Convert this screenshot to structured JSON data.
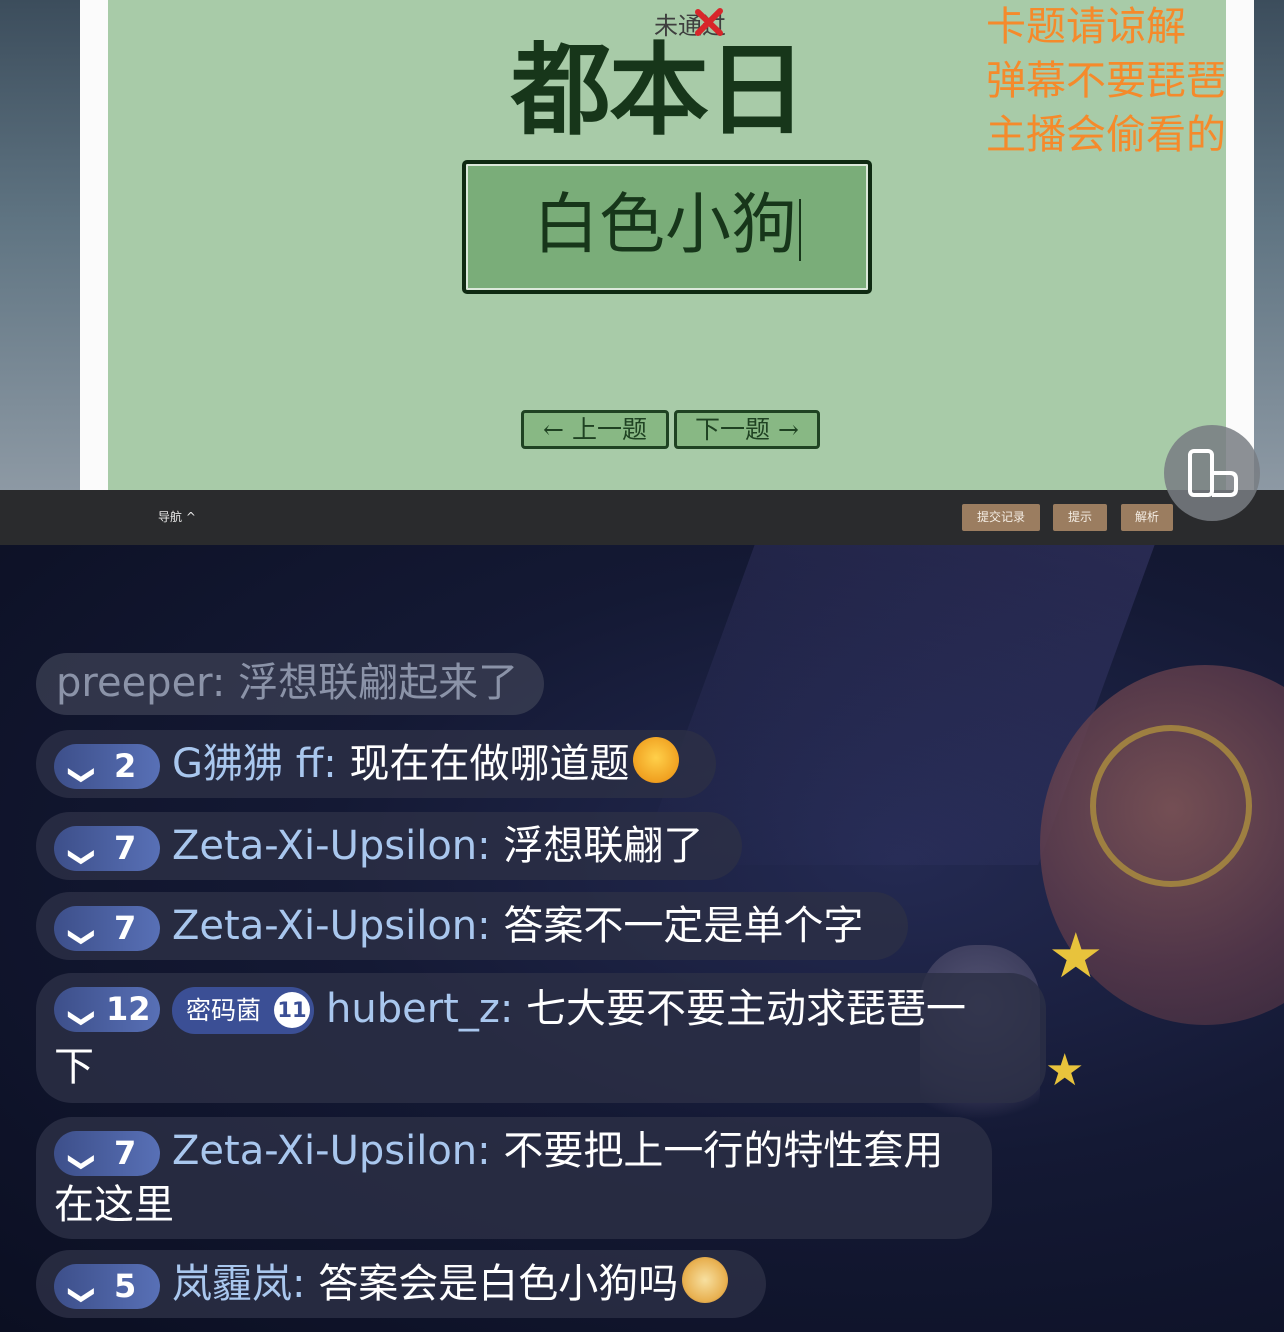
{
  "stream": {
    "status_text": "未通过",
    "question": "都本日",
    "answer": "白色小狗",
    "prev_button": "←  上一题",
    "next_button": "下一题  →",
    "notice_lines": [
      "卡题请谅解",
      "弹幕不要琵琶",
      "主播会偷看的"
    ]
  },
  "toolbar": {
    "nav_label": "导航 ^",
    "submissions_label": "提交记录",
    "hint_label": "提示",
    "analysis_label": "解析"
  },
  "chat": {
    "messages": [
      {
        "user": "preeper:",
        "text": " 浮想联翩起来了"
      },
      {
        "level": "2",
        "user": "G狒狒 ff:",
        "text": " 现在在做哪道题",
        "emoji": "starstruck-emoji"
      },
      {
        "level": "7",
        "user": "Zeta-Xi-Upsilon:",
        "text": " 浮想联翩了"
      },
      {
        "level": "7",
        "user": "Zeta-Xi-Upsilon:",
        "text": " 答案不一定是单个字"
      },
      {
        "level": "12",
        "fan_tag": "密码菌",
        "fan_level": "11",
        "user": "hubert_z:",
        "text": " 七大要不要主动求琵琶一",
        "text_line2": "下"
      },
      {
        "level": "7",
        "user": "Zeta-Xi-Upsilon:",
        "text": " 不要把上一行的特性套用",
        "text_line2": "在这里"
      },
      {
        "level": "5",
        "user": "岚霾岚:",
        "text": " 答案会是白色小狗吗",
        "emoji": "doge-emoji"
      }
    ]
  },
  "colors": {
    "page_bg": "#a8cba8",
    "answer_box": "#7aad79",
    "notice": "#f58a2b",
    "fail_mark": "#d8262a",
    "toolbar_button": "#9b7d60",
    "username": "#a9c7ee",
    "level_badge": "#4a62a8"
  }
}
